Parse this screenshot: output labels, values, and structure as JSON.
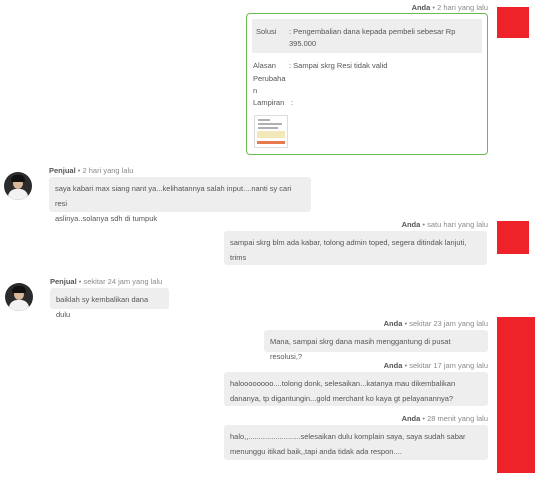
{
  "messages": [
    {
      "sender": "Anda",
      "time": "2 hari yang lalu",
      "card": {
        "solusi_label": "Solusi",
        "solusi_value": ": Pengembalian dana kepada pembeli sebesar Rp",
        "solusi_amount": "395.000",
        "alasan_label": "Alasan",
        "alasan_value": ": Sampai skrg Resi tidak valid",
        "perubahan_label": "Perubaha",
        "perubahan_label_2": "n",
        "lampiran_label": "Lampiran",
        "lampiran_value": ":"
      }
    },
    {
      "sender": "Penjual",
      "time": "2 hari yang lalu",
      "lines": [
        "saya kabari max siang nant ya...kelihatannya salah input....nanti sy cari resi",
        "aslinya..solanya sdh di tumpuk"
      ]
    },
    {
      "sender": "Anda",
      "time": "satu hari yang lalu",
      "lines": [
        "sampai skrg blm ada kabar, tolong admin toped, segera ditindak lanjuti,",
        "trims"
      ]
    },
    {
      "sender": "Penjual",
      "time": "sekitar 24 jam yang lalu",
      "lines": [
        "baiklah sy kembalikan dana dulu"
      ]
    },
    {
      "sender": "Anda",
      "time": "sekitar 23 jam yang lalu",
      "lines": [
        "Mana, sampai skrg dana masih menggantung di pusat resolusi,?"
      ]
    },
    {
      "sender": "Anda",
      "time": "sekitar 17 jam yang lalu",
      "lines": [
        "haloooooooo....tolong donk, selesaikan...katanya mau dikembalikan",
        "dananya, tp digantungin...gold merchant ko kaya gt pelayanannya?"
      ]
    },
    {
      "sender": "Anda",
      "time": "28 menit yang lalu",
      "lines": [
        "halo,,.........................selesaikan dulu komplain saya, saya sudah sabar",
        "menunggu itikad baik,,tapi anda tidak ada respon...."
      ]
    }
  ],
  "colors": {
    "avatar_red": "#ee2229",
    "card_border": "#6dbb4f",
    "bubble_bg": "#eeeeee"
  },
  "icons": {
    "buyer_avatar": "red-square-avatar",
    "seller_avatar": "user-photo-avatar",
    "attachment": "attachment-thumbnail"
  }
}
